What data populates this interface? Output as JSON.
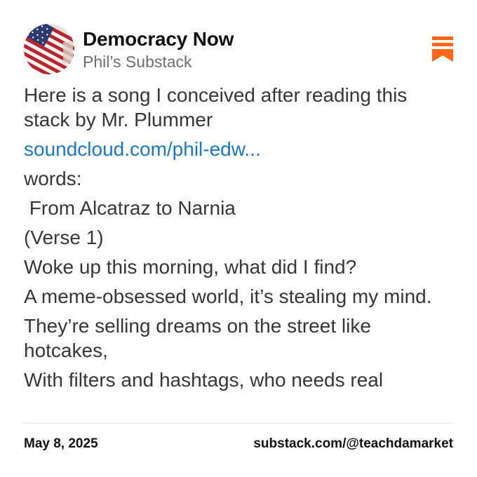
{
  "header": {
    "publication": "Democracy Now",
    "subtitle": "Phil’s Substack",
    "avatar_icon": "american-flag-icon",
    "bookmark_icon": "substack-logo-icon",
    "accent_color": "#FF6719"
  },
  "post": {
    "lines": [
      "Here is a song I conceived after reading this stack by Mr. Plummer",
      "soundcloud.com/phil-edw...",
      "words:",
      " From Alcatraz to Narnia",
      "(Verse 1)",
      "Woke up this morning, what did I find?",
      "A meme-obsessed world, it’s stealing my mind.",
      "They’re selling dreams on the street like hotcakes,",
      "With filters and hashtags, who needs real"
    ],
    "link_color": "#1A79C7"
  },
  "footer": {
    "date": "May 8, 2025",
    "handle": "substack.com/@teachdamarket"
  }
}
